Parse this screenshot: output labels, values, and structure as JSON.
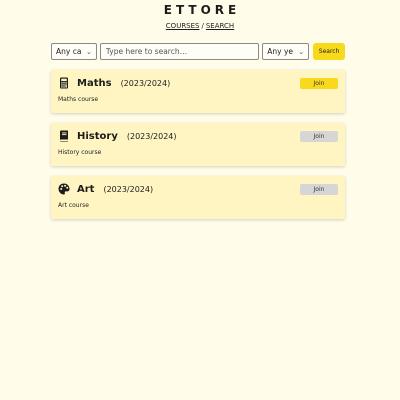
{
  "header": {
    "brand": "ETTORE",
    "nav": {
      "courses": "COURSES",
      "separator": "/",
      "search": "SEARCH"
    }
  },
  "filters": {
    "category_value": "Any ca",
    "search_placeholder": "Type here to search…",
    "year_value": "Any ye",
    "search_button": "Search"
  },
  "courses": [
    {
      "icon": "calculator-icon",
      "title": "Maths",
      "year": "(2023/2024)",
      "description": "Maths course",
      "join_label": "Join",
      "join_state": "active"
    },
    {
      "icon": "book-icon",
      "title": "History",
      "year": "(2023/2024)",
      "description": "History course",
      "join_label": "Join",
      "join_state": "muted"
    },
    {
      "icon": "palette-icon",
      "title": "Art",
      "year": "(2023/2024)",
      "description": "Art course",
      "join_label": "Join",
      "join_state": "muted"
    }
  ],
  "colors": {
    "background": "#fffde9",
    "card": "#fff5c2",
    "accent": "#f9d91c",
    "muted_button": "#d6d6d6"
  }
}
